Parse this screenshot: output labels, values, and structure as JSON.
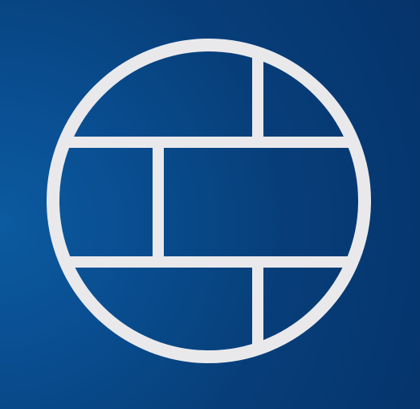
{
  "icon": {
    "name": "firewall-globe-icon",
    "background_colors": [
      "#0c5aa0",
      "#094d8f",
      "#073e79",
      "#06336a"
    ],
    "glyph_color": "#e9e9ec"
  }
}
